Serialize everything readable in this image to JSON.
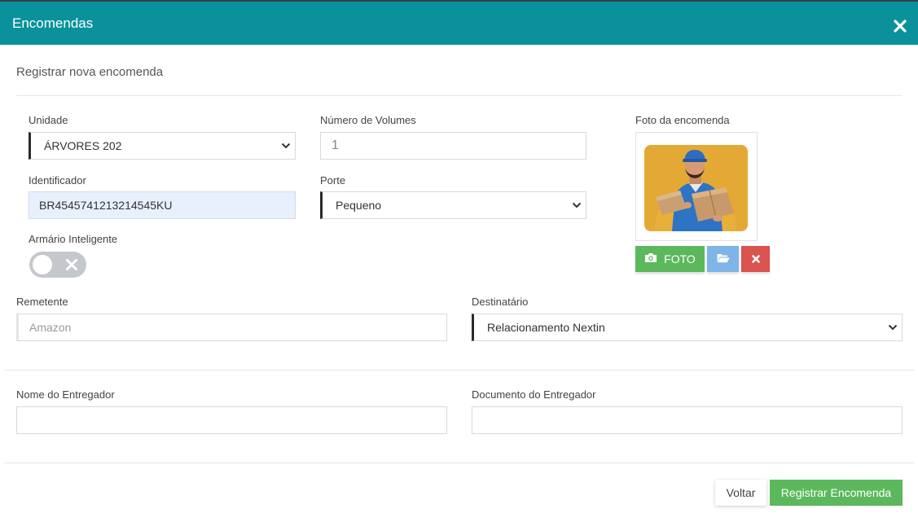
{
  "modal": {
    "title": "Encomendas",
    "subtitle": "Registrar nova encomenda",
    "close_icon": "close-icon"
  },
  "form": {
    "unidade": {
      "label": "Unidade",
      "value": "ÁRVORES 202"
    },
    "volumes": {
      "label": "Número de Volumes",
      "value": "1"
    },
    "identificador": {
      "label": "Identificador",
      "value": "BR4545741213214545KU"
    },
    "porte": {
      "label": "Porte",
      "value": "Pequeno"
    },
    "armario": {
      "label": "Armário Inteligente",
      "enabled": false
    },
    "remetente": {
      "label": "Remetente",
      "placeholder": "Amazon"
    },
    "destinatario": {
      "label": "Destinatário",
      "value": "Relacionamento Nextin"
    },
    "nome_entregador": {
      "label": "Nome do Entregador",
      "value": ""
    },
    "documento_entregador": {
      "label": "Documento do Entregador",
      "value": ""
    }
  },
  "photo": {
    "label": "Foto da encomenda",
    "foto_button": "FOTO",
    "icons": [
      "camera-icon",
      "folder-open-icon",
      "delete-icon"
    ]
  },
  "footer": {
    "voltar": "Voltar",
    "registrar": "Registrar Encomenda"
  },
  "colors": {
    "header": "#0b919b",
    "success": "#5cb85c",
    "info": "#7fb4e8",
    "danger": "#d9534f",
    "autofill": "#e8f0fe"
  }
}
